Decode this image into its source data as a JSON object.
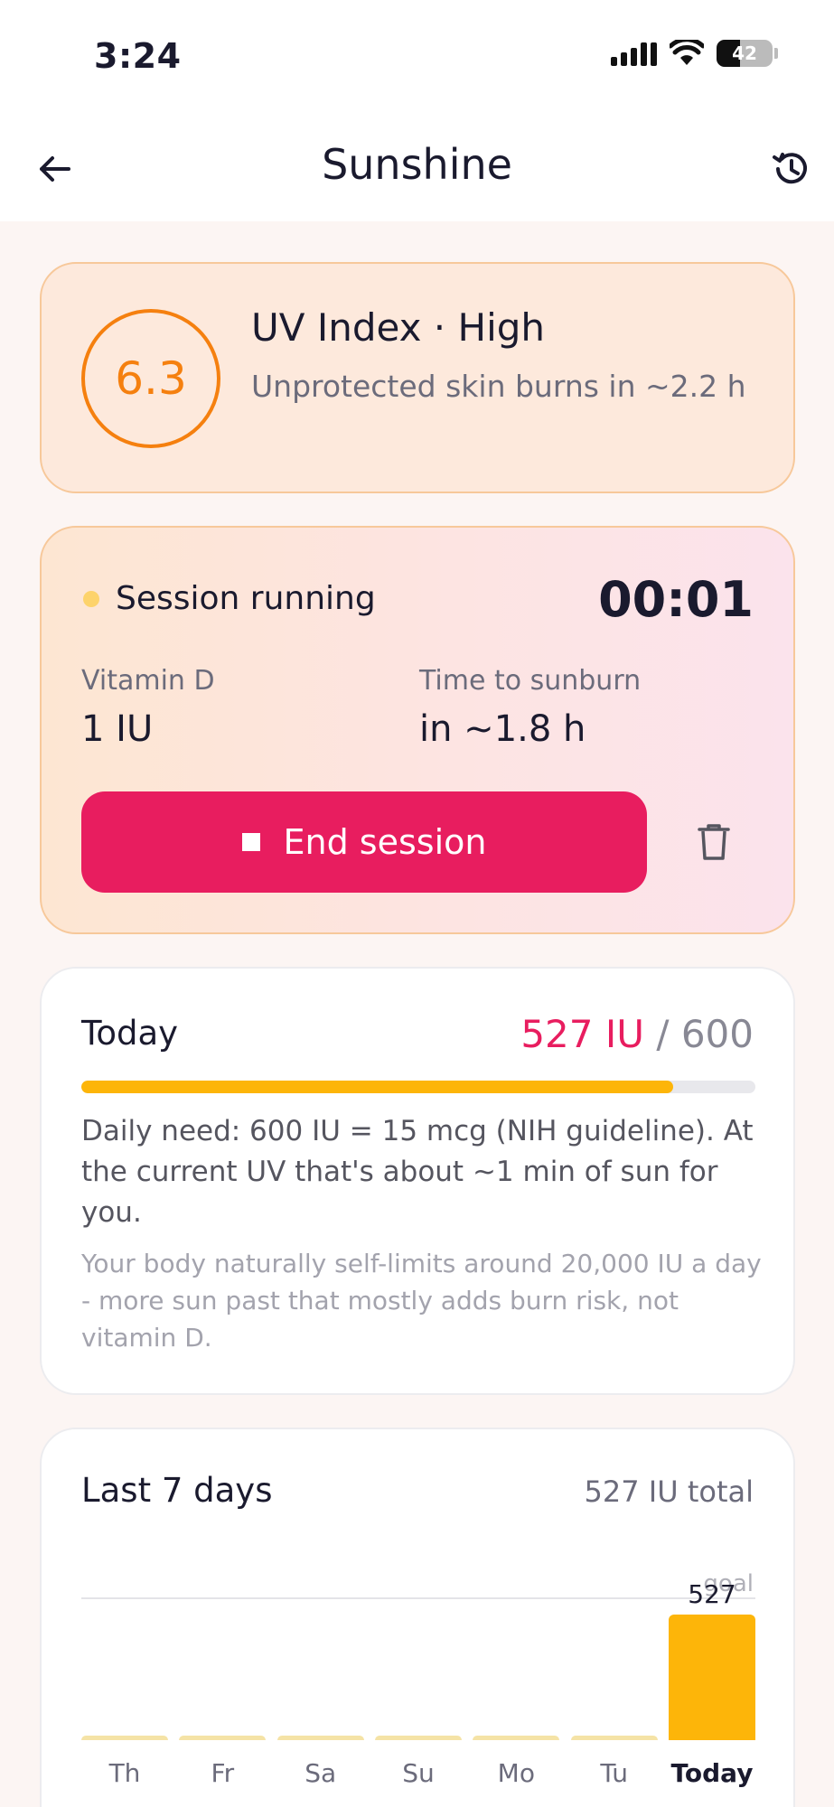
{
  "status_bar": {
    "time": "3:24",
    "battery": "42"
  },
  "header": {
    "title": "Sunshine"
  },
  "uv": {
    "value": "6.3",
    "title": "UV Index · High",
    "description": "Unprotected skin burns in ~2.2 h"
  },
  "session": {
    "status": "Session running",
    "timer": "00:01",
    "vitamin_label": "Vitamin D",
    "vitamin_value": "1 IU",
    "sunburn_label": "Time to sunburn",
    "sunburn_value": "in ~1.8 h",
    "end_label": "End session"
  },
  "today": {
    "title": "Today",
    "iu_value": "527 IU",
    "goal": "/ 600",
    "progress": 0.878,
    "need_text": "Daily need: 600 IU = 15 mcg (NIH guideline). At the current UV that's about ~1 min of sun for you.",
    "note_text": "Your body naturally self-limits around 20,000 IU a day - more sun past that mostly adds burn risk, not vitamin D."
  },
  "week": {
    "title": "Last 7 days",
    "total": "527 IU total",
    "goal_label": "goal"
  },
  "chart_data": {
    "type": "bar",
    "categories": [
      "Th",
      "Fr",
      "Sa",
      "Su",
      "Mo",
      "Tu",
      "Today"
    ],
    "values": [
      0,
      0,
      0,
      0,
      0,
      0,
      527
    ],
    "data_labels": [
      "",
      "",
      "",
      "",
      "",
      "",
      "527"
    ],
    "goal": 600,
    "ylim": [
      0,
      600
    ]
  },
  "colors": {
    "accent": "#e81d5f",
    "uv_orange": "#f5800f",
    "bar_today": "#fdb509",
    "bar_other": "#f5e3a6"
  },
  "icons": {
    "back": "arrow-left-icon",
    "history": "history-icon",
    "stop": "stop-icon",
    "trash": "trash-icon"
  }
}
